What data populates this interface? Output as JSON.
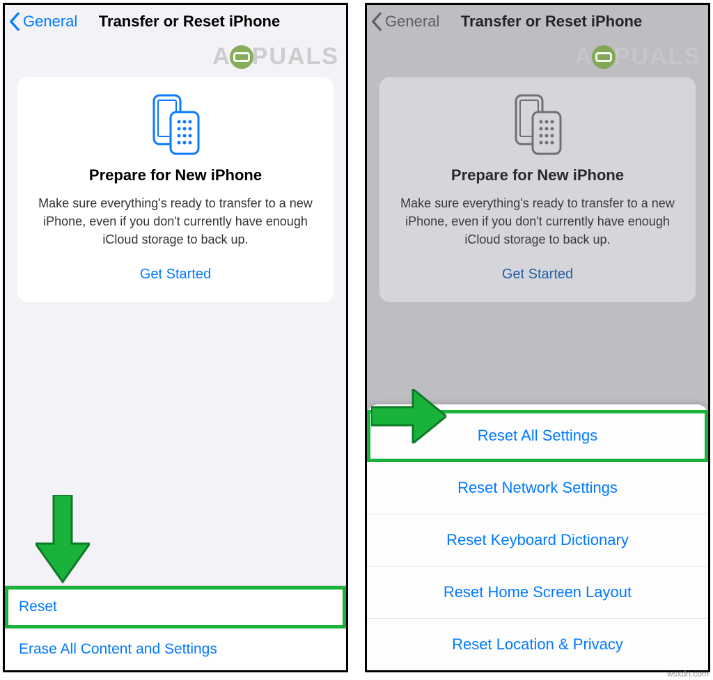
{
  "watermark_text_left": "A",
  "watermark_text_right": "PUALS",
  "footer_text": "wsxdn.com",
  "left": {
    "back_label": "General",
    "title": "Transfer or Reset iPhone",
    "card": {
      "title": "Prepare for New iPhone",
      "desc": "Make sure everything's ready to transfer to a new iPhone, even if you don't currently have enough iCloud storage to back up.",
      "cta": "Get Started"
    },
    "list": {
      "reset": "Reset",
      "erase": "Erase All Content and Settings"
    }
  },
  "right": {
    "back_label": "General",
    "title": "Transfer or Reset iPhone",
    "card": {
      "title": "Prepare for New iPhone",
      "desc": "Make sure everything's ready to transfer to a new iPhone, even if you don't currently have enough iCloud storage to back up.",
      "cta": "Get Started"
    },
    "sheet": {
      "o0": "Reset All Settings",
      "o1": "Reset Network Settings",
      "o2": "Reset Keyboard Dictionary",
      "o3": "Reset Home Screen Layout",
      "o4": "Reset Location & Privacy"
    }
  }
}
